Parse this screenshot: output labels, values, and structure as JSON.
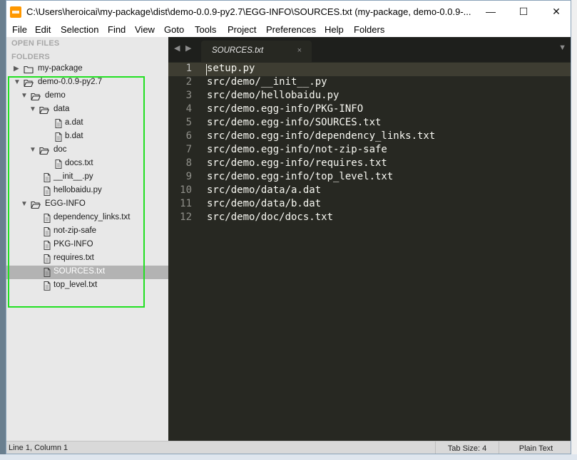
{
  "window": {
    "title": "C:\\Users\\heroicai\\my-package\\dist\\demo-0.0.9-py2.7\\EGG-INFO\\SOURCES.txt (my-package, demo-0.0.9-...",
    "minimize_glyph": "—",
    "maximize_glyph": "☐",
    "close_glyph": "✕"
  },
  "menu": [
    "File",
    "Edit",
    "Selection",
    "Find",
    "View",
    "Goto",
    "Tools",
    "Project",
    "Preferences",
    "Help",
    "Folders"
  ],
  "sidebar": {
    "open_files_heading": "OPEN FILES",
    "folders_heading": "FOLDERS",
    "tree": [
      {
        "label": "my-package",
        "type": "folder",
        "expanded": false,
        "depth": 0
      },
      {
        "label": "demo-0.0.9-py2.7",
        "type": "folder",
        "expanded": true,
        "depth": 0
      },
      {
        "label": "demo",
        "type": "folder",
        "expanded": true,
        "depth": 1
      },
      {
        "label": "data",
        "type": "folder",
        "expanded": true,
        "depth": 2
      },
      {
        "label": "a.dat",
        "type": "file",
        "depth": 3
      },
      {
        "label": "b.dat",
        "type": "file",
        "depth": 3
      },
      {
        "label": "doc",
        "type": "folder",
        "expanded": true,
        "depth": 2
      },
      {
        "label": "docs.txt",
        "type": "file",
        "depth": 3
      },
      {
        "label": "__init__.py",
        "type": "file",
        "depth": 2
      },
      {
        "label": "hellobaidu.py",
        "type": "file",
        "depth": 2
      },
      {
        "label": "EGG-INFO",
        "type": "folder",
        "expanded": true,
        "depth": 1
      },
      {
        "label": "dependency_links.txt",
        "type": "file",
        "depth": 2
      },
      {
        "label": "not-zip-safe",
        "type": "file",
        "depth": 2
      },
      {
        "label": "PKG-INFO",
        "type": "file",
        "depth": 2
      },
      {
        "label": "requires.txt",
        "type": "file",
        "depth": 2
      },
      {
        "label": "SOURCES.txt",
        "type": "file",
        "depth": 2,
        "selected": true
      },
      {
        "label": "top_level.txt",
        "type": "file",
        "depth": 2
      }
    ]
  },
  "editor": {
    "tab_label": "SOURCES.txt",
    "tab_close_glyph": "×",
    "current_line": 1,
    "lines": [
      "setup.py",
      "src/demo/__init__.py",
      "src/demo/hellobaidu.py",
      "src/demo.egg-info/PKG-INFO",
      "src/demo.egg-info/SOURCES.txt",
      "src/demo.egg-info/dependency_links.txt",
      "src/demo.egg-info/not-zip-safe",
      "src/demo.egg-info/requires.txt",
      "src/demo.egg-info/top_level.txt",
      "src/demo/data/a.dat",
      "src/demo/data/b.dat",
      "src/demo/doc/docs.txt"
    ]
  },
  "statusbar": {
    "position": "Line 1, Column 1",
    "tab_size": "Tab Size: 4",
    "syntax": "Plain Text"
  },
  "colors": {
    "editor_bg": "#272822",
    "sidebar_bg": "#e8e8e8",
    "highlight_box": "#22e022",
    "selected_row": "#b3b3b3"
  }
}
